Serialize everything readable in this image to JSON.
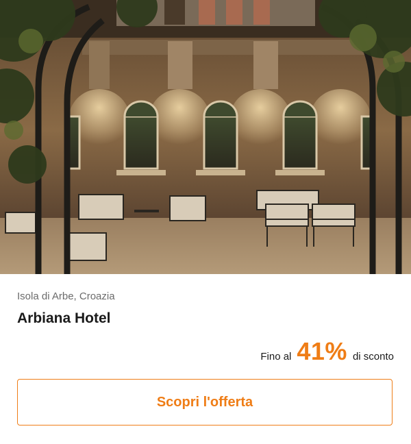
{
  "hero": {
    "image_icon": "hotel-terrace-photo"
  },
  "offer": {
    "location": "Isola di Arbe, Croazia",
    "hotel_name": "Arbiana Hotel",
    "discount_prefix": "Fino al",
    "discount_value": "41%",
    "discount_suffix": "di sconto",
    "cta_label": "Scopri l'offerta"
  },
  "colors": {
    "accent": "#ef7d16",
    "text_primary": "#1a1a1a",
    "text_secondary": "#6b6b6b"
  }
}
